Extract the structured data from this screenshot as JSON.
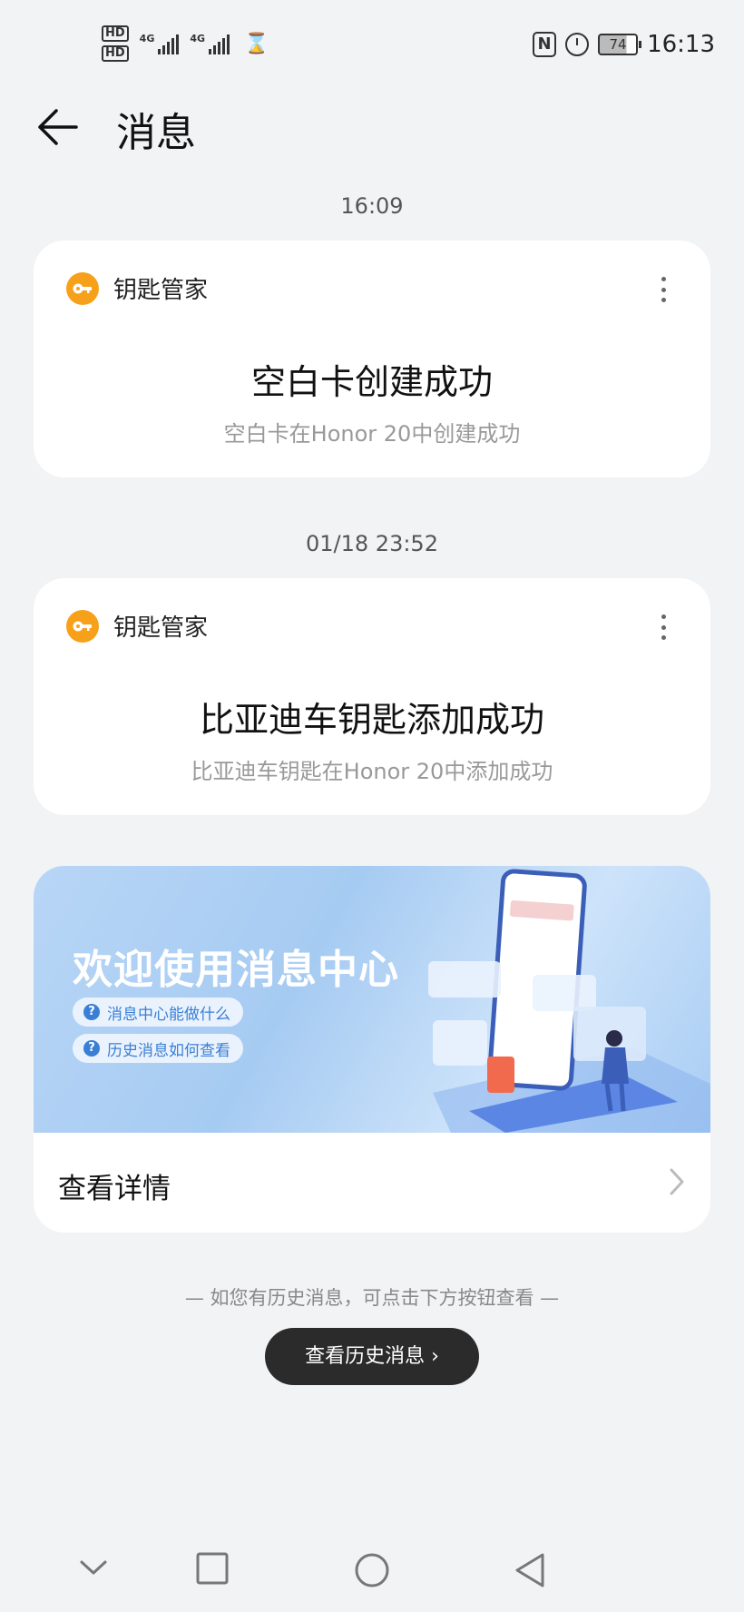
{
  "status_bar": {
    "hd1": "HD",
    "hd2": "HD",
    "net1": "4G",
    "net2": "4G",
    "battery": "74",
    "time": "16:13"
  },
  "header": {
    "title": "消息"
  },
  "messages": [
    {
      "time": "16:09",
      "app_name": "钥匙管家",
      "title": "空白卡创建成功",
      "subtitle": "空白卡在Honor 20中创建成功"
    },
    {
      "time": "01/18 23:52",
      "app_name": "钥匙管家",
      "title": "比亚迪车钥匙添加成功",
      "subtitle": "比亚迪车钥匙在Honor 20中添加成功"
    }
  ],
  "banner": {
    "title": "欢迎使用消息中心",
    "pill1": "消息中心能做什么",
    "pill2": "历史消息如何查看",
    "detail_label": "查看详情"
  },
  "footer": {
    "hint": "—   如您有历史消息，可点击下方按钮查看   —",
    "history_button": "查看历史消息 ›"
  },
  "colors": {
    "accent_orange": "#f7a01a",
    "button_dark": "#2b2b2b",
    "banner_blue": "#a6cbf2"
  }
}
